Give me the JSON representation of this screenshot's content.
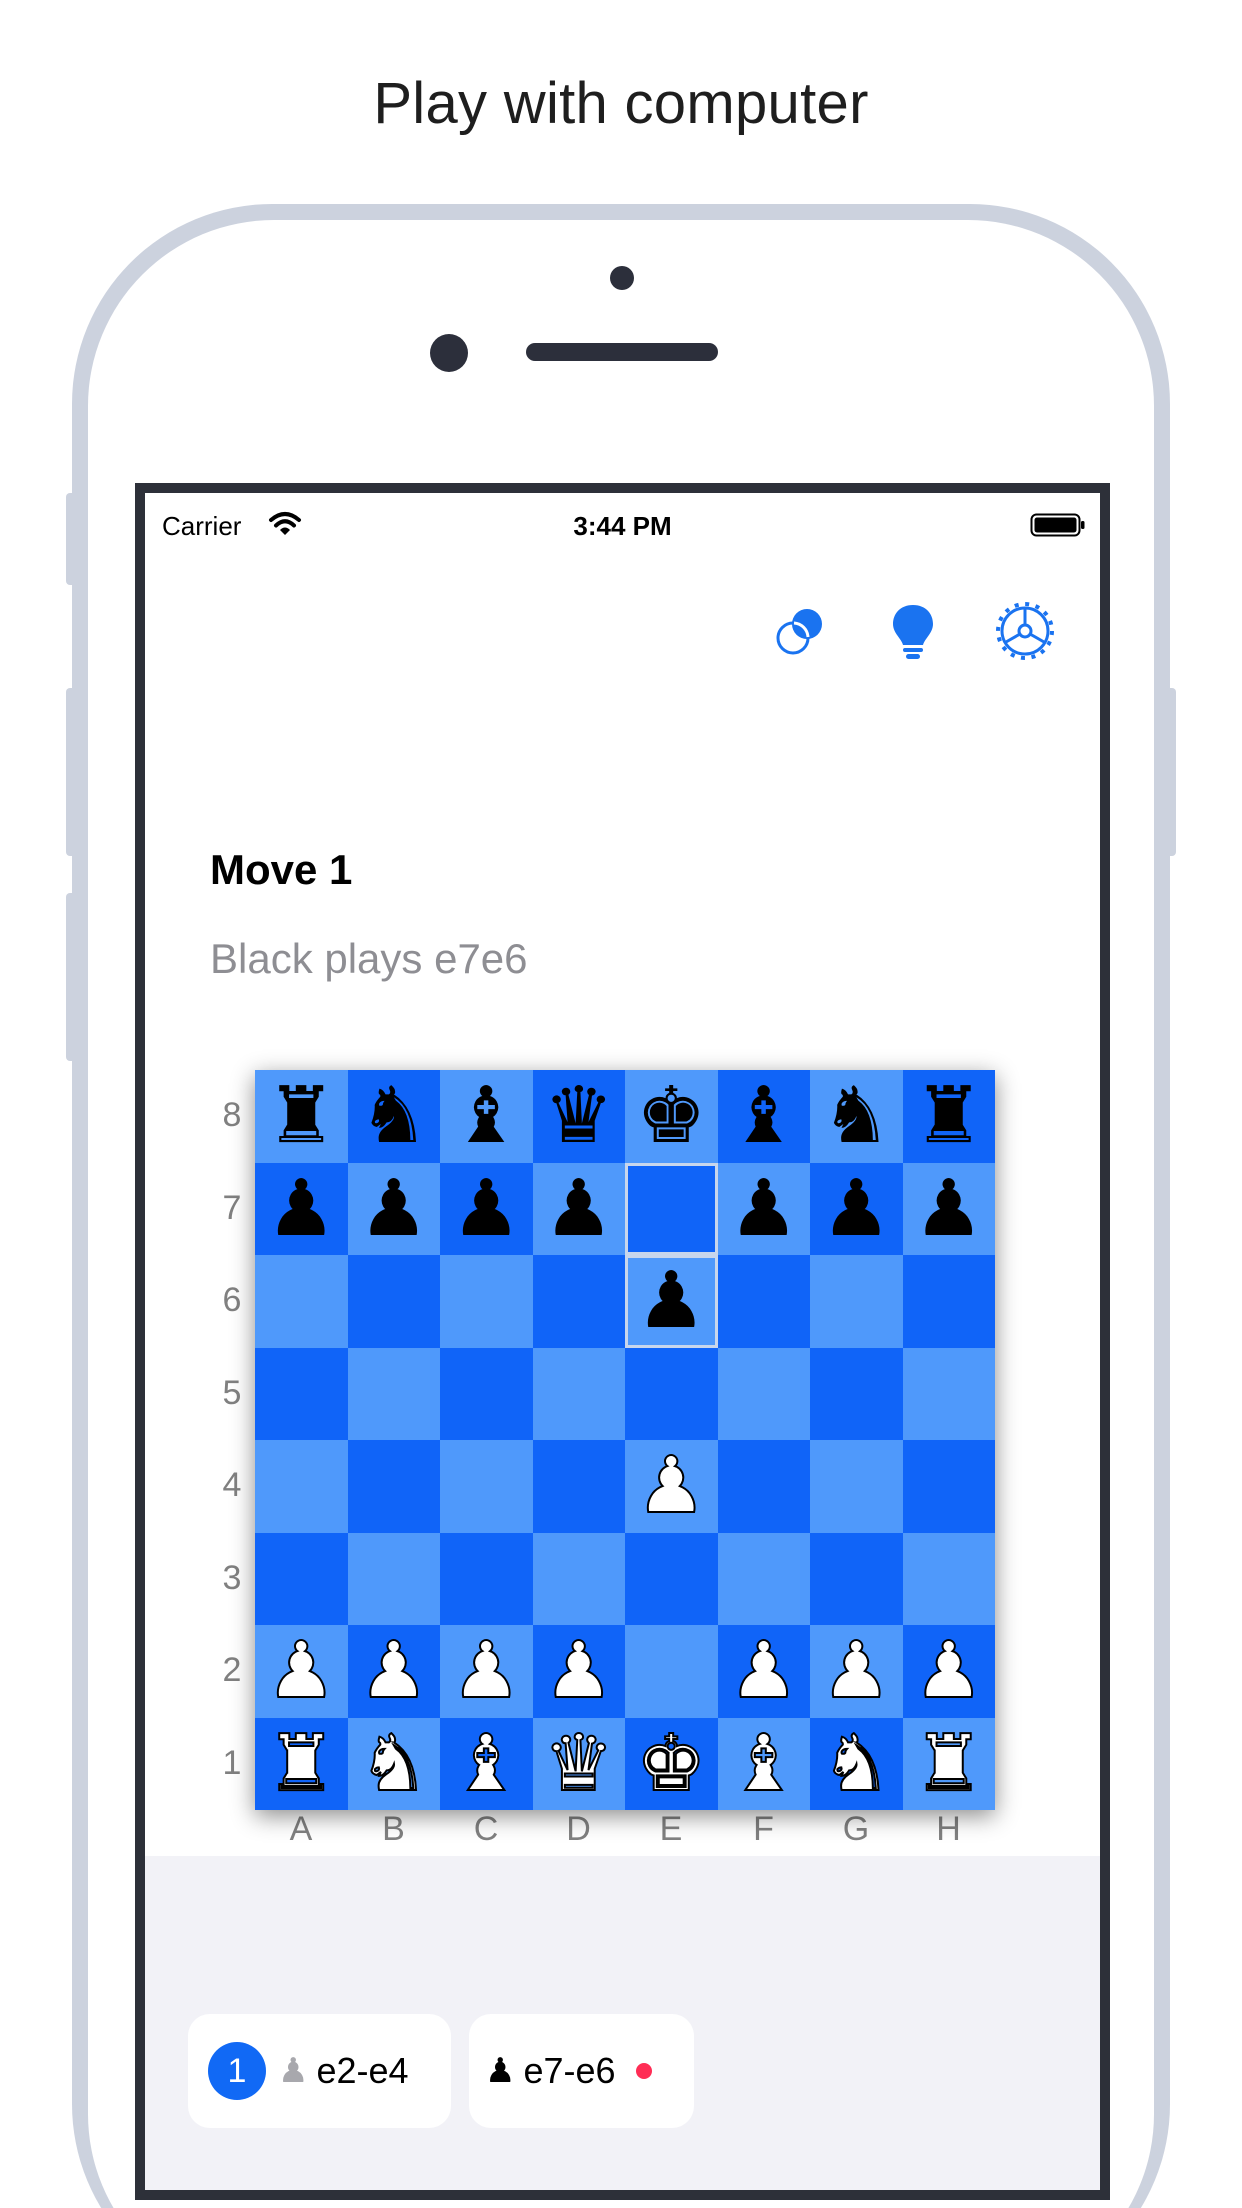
{
  "headline": "Play with computer",
  "status_bar": {
    "carrier": "Carrier",
    "time": "3:44 PM"
  },
  "toolbar": {
    "icons": [
      "theme-toggle-icon",
      "hint-lightbulb-icon",
      "settings-gear-icon"
    ],
    "accent": "#1a73f0"
  },
  "game": {
    "move_title": "Move 1",
    "move_description": "Black plays e7e6"
  },
  "board": {
    "files": [
      "A",
      "B",
      "C",
      "D",
      "E",
      "F",
      "G",
      "H"
    ],
    "ranks": [
      "8",
      "7",
      "6",
      "5",
      "4",
      "3",
      "2",
      "1"
    ],
    "light_color": "#4f99fb",
    "dark_color": "#1064f8",
    "position": [
      [
        "r",
        "n",
        "b",
        "q",
        "k",
        "b",
        "n",
        "r"
      ],
      [
        "p",
        "p",
        "p",
        "p",
        "",
        "p",
        "p",
        "p"
      ],
      [
        "",
        "",
        "",
        "",
        "p",
        "",
        "",
        ""
      ],
      [
        "",
        "",
        "",
        "",
        "",
        "",
        "",
        ""
      ],
      [
        "",
        "",
        "",
        "",
        "P",
        "",
        "",
        ""
      ],
      [
        "",
        "",
        "",
        "",
        "",
        "",
        "",
        ""
      ],
      [
        "P",
        "P",
        "P",
        "P",
        "",
        "P",
        "P",
        "P"
      ],
      [
        "R",
        "N",
        "B",
        "Q",
        "K",
        "B",
        "N",
        "R"
      ]
    ],
    "highlighted_squares": [
      "e7",
      "e6"
    ]
  },
  "move_list": [
    {
      "number": "1",
      "move": "e2-e4",
      "side": "white"
    },
    {
      "move": "e7-e6",
      "side": "black",
      "current": true
    }
  ]
}
